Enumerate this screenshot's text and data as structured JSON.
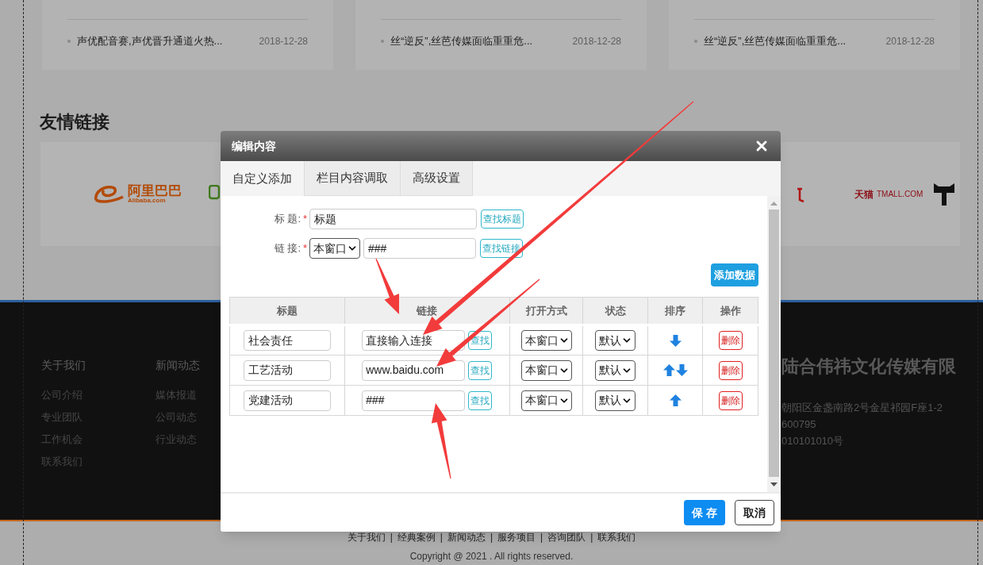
{
  "news_cards": [
    {
      "title": "声优配音赛,声优晋升通道火热...",
      "date": "2018-12-28"
    },
    {
      "title": "丝“逆反”,丝芭传媒面临重重危...",
      "date": "2018-12-28"
    },
    {
      "title": "丝“逆反”,丝芭传媒面临重重危...",
      "date": "2018-12-28"
    }
  ],
  "friend_links": {
    "heading": "友情链接",
    "logos": [
      {
        "kind": "alibaba",
        "name": "阿里巴巴",
        "domain": "Alibaba.com"
      },
      {
        "kind": "green-mark"
      },
      {
        "kind": "red-mark"
      },
      {
        "kind": "tmall",
        "name": "天猫",
        "domain": "TMALL.COM"
      }
    ]
  },
  "footer": {
    "columns": [
      {
        "title": "关于我们",
        "links": [
          "公司介绍",
          "专业团队",
          "工作机会",
          "联系我们"
        ]
      },
      {
        "title": "新闻动态",
        "links": [
          "媒体报道",
          "公司动态",
          "行业动态"
        ]
      }
    ],
    "company": "陆合伟祎文化传媒有限",
    "contact": [
      "朝阳区金盏南路2号金星祁园F座1-2",
      "600795",
      "010101010号"
    ],
    "bottom_links": [
      "关于我们",
      "经典案例",
      "新闻动态",
      "服务项目",
      "咨询团队",
      "联系我们"
    ],
    "separator": "|",
    "copyright": "Copyright @ 2021 . All rights reserved."
  },
  "dialog": {
    "title": "编辑内容",
    "tabs": [
      {
        "label": "自定义添加",
        "selected": true
      },
      {
        "label": "栏目内容调取",
        "selected": false
      },
      {
        "label": "高级设置",
        "selected": false
      }
    ],
    "form": {
      "required_mark": "*",
      "title_label": "标 题:",
      "title_value": "标题",
      "title_button": "查找标题",
      "link_label": "链 接:",
      "target": "本窗口",
      "link_value": "###",
      "link_button": "查找链接"
    },
    "add_button": "添加数据",
    "table": {
      "columns": [
        "标题",
        "链接",
        "打开方式",
        "状态",
        "排序",
        "操作"
      ],
      "rows": [
        {
          "title": "社会责任",
          "link": "直接输入连接",
          "find": "查找",
          "target": "本窗口",
          "status": "默认",
          "up": false,
          "down": true,
          "delete": "删除"
        },
        {
          "title": "工艺活动",
          "link": "www.baidu.com",
          "find": "查找",
          "target": "本窗口",
          "status": "默认",
          "up": true,
          "down": true,
          "delete": "删除"
        },
        {
          "title": "党建活动",
          "link": "###",
          "find": "查找",
          "target": "本窗口",
          "status": "默认",
          "up": true,
          "down": false,
          "delete": "删除"
        }
      ]
    },
    "buttons": [
      {
        "label": "保 存",
        "kind": "primary"
      },
      {
        "label": "取消",
        "kind": "default"
      }
    ]
  }
}
